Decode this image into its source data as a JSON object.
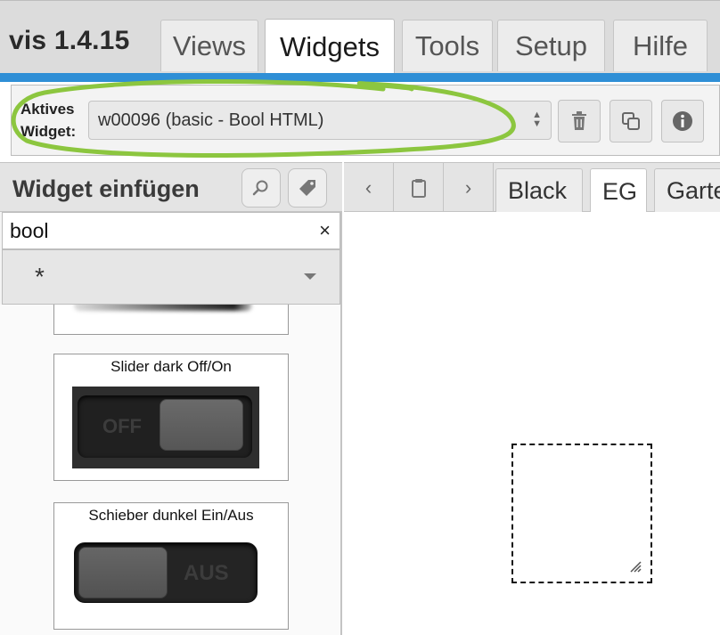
{
  "app": {
    "title": "vis 1.4.15"
  },
  "menu": {
    "tabs": [
      {
        "label": "Views"
      },
      {
        "label": "Widgets"
      },
      {
        "label": "Tools"
      },
      {
        "label": "Setup"
      },
      {
        "label": "Hilfe"
      }
    ],
    "active_tab": "Widgets"
  },
  "active_widget": {
    "label": "Aktives Widget:",
    "value": "w00096 (basic - Bool HTML)",
    "buttons": [
      {
        "icon": "trash-icon"
      },
      {
        "icon": "copy-icon"
      },
      {
        "icon": "info-icon"
      }
    ]
  },
  "insert_panel": {
    "title": "Widget einfügen",
    "filter_value": "bool",
    "clear_label": "×",
    "set_value": "*",
    "widgets": [
      {
        "title": "Slider dark Off/On",
        "state_text": "OFF"
      },
      {
        "title": "Schieber dunkel Ein/Aus",
        "state_text": "AUS"
      }
    ]
  },
  "views": {
    "nav": {
      "prev": "‹",
      "next": "›"
    },
    "tabs": [
      {
        "label": "Black"
      },
      {
        "label": "EG"
      },
      {
        "label": "Garten"
      }
    ],
    "active_tab": "EG"
  },
  "colors": {
    "accent_bar": "#2f8fd6",
    "annotation_circle": "#8cc63f"
  }
}
